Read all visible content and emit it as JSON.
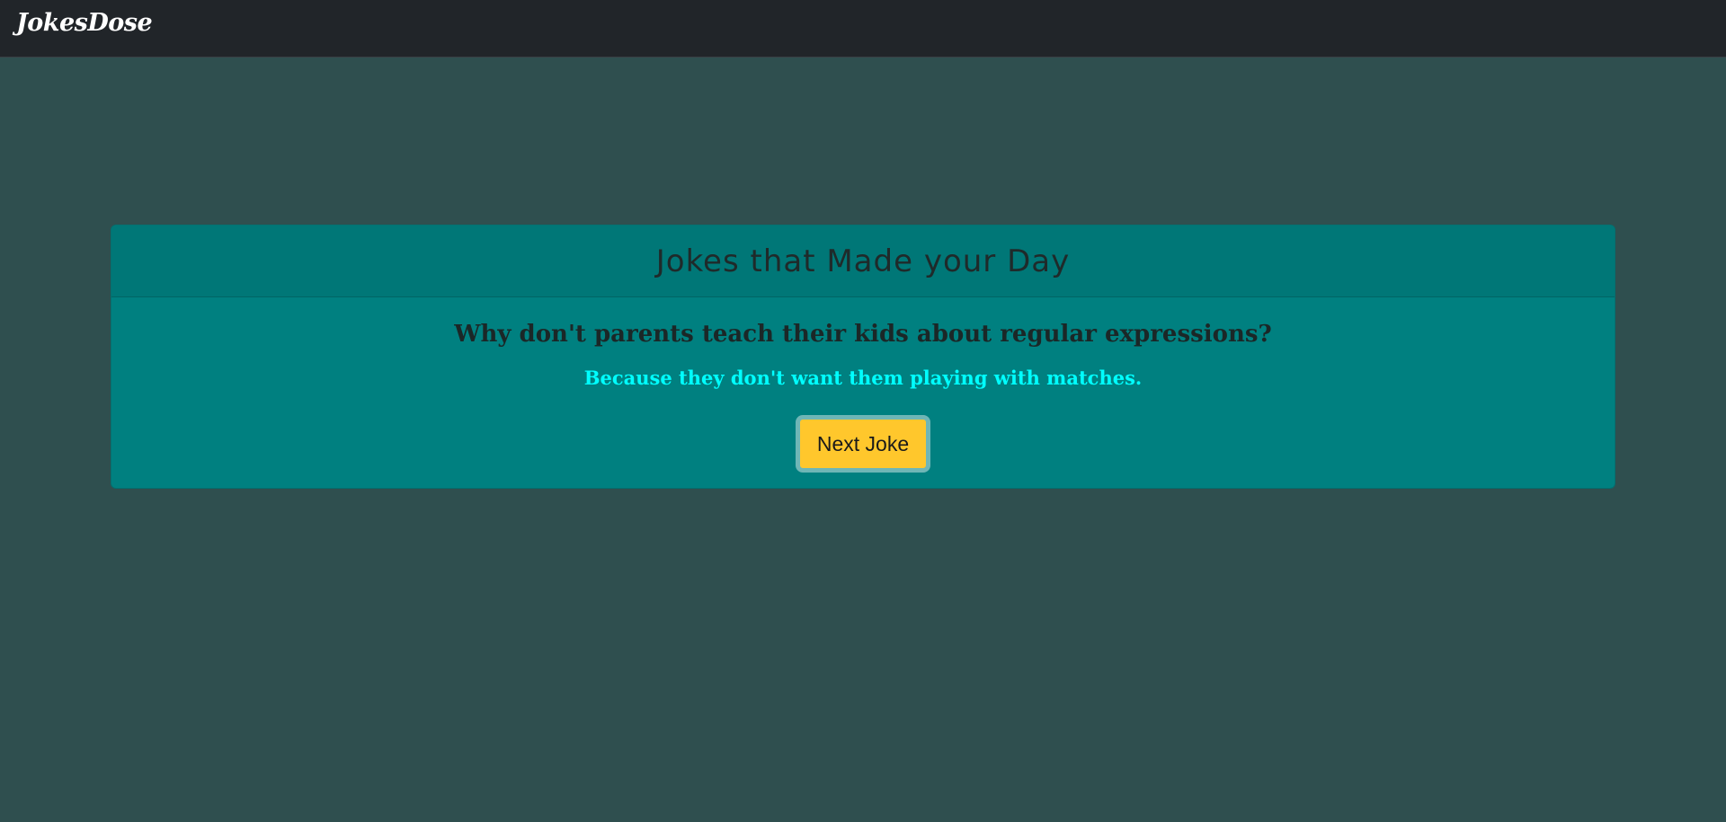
{
  "navbar": {
    "brand": "JokesDose"
  },
  "card": {
    "header_title": "Jokes that Made your Day",
    "question": "Why don't parents teach their kids about regular expressions?",
    "answer": "Because they don't want them playing with matches.",
    "next_button_label": "Next Joke"
  },
  "colors": {
    "page_background": "#2f4f4f",
    "navbar_background": "#212529",
    "card_background": "#008080",
    "answer_text": "#00ffff",
    "button_background": "#ffc72c"
  }
}
